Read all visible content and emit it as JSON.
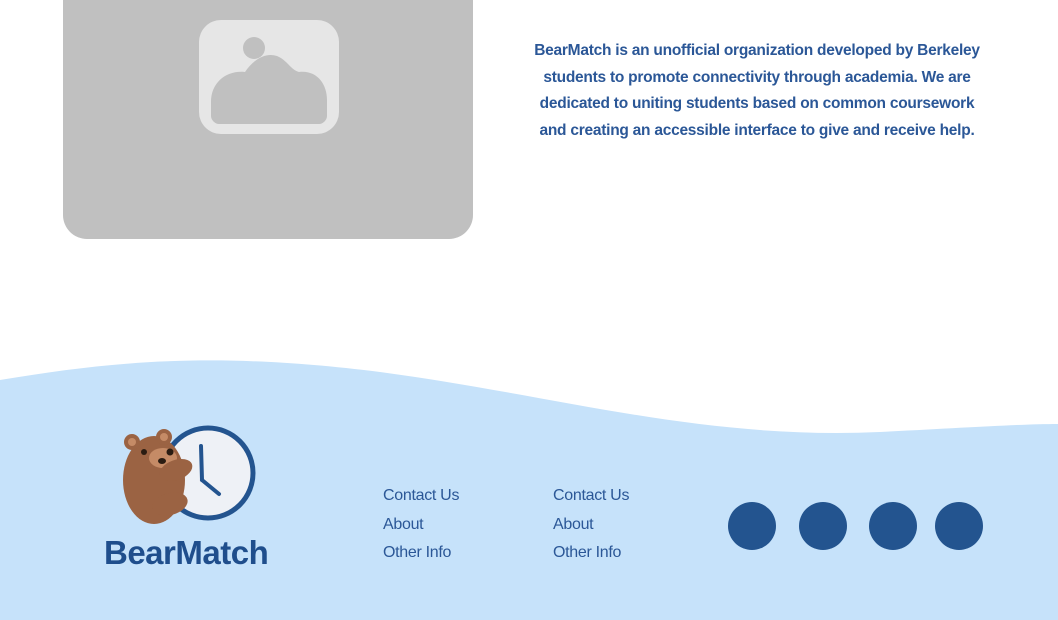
{
  "about": {
    "text": "BearMatch is an unofficial organization developed by Berkeley students to promote connectivity through academia. We are dedicated to uniting students based on common coursework and creating an accessible interface to give and receive help."
  },
  "footer": {
    "brand": "BearMatch",
    "link_columns": [
      {
        "links": [
          "Contact Us",
          "About",
          "Other Info"
        ]
      },
      {
        "links": [
          "Contact Us",
          "About",
          "Other Info"
        ]
      }
    ],
    "social_icons": [
      "social-icon",
      "social-icon",
      "social-icon",
      "social-icon"
    ]
  },
  "colors": {
    "accent": "#2b5797",
    "footer_bg": "#c6e2fa",
    "placeholder_bg": "#c0c0c0",
    "social_circle": "#23548f"
  }
}
